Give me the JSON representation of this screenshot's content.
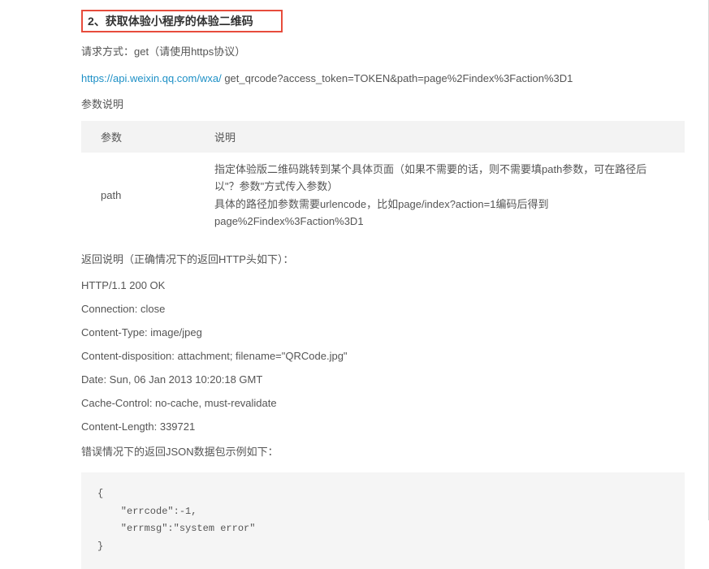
{
  "heading": "2、获取体验小程序的体验二维码",
  "request_method": "请求方式：get（请使用https协议）",
  "api": {
    "link": "https://api.weixin.qq.com/wxa/",
    "rest": " get_qrcode?access_token=TOKEN&path=page%2Findex%3Faction%3D1"
  },
  "param_label": "参数说明",
  "table": {
    "header_param": "参数",
    "header_desc": "说明",
    "row": {
      "param": "path",
      "desc_line1": "指定体验版二维码跳转到某个具体页面（如果不需要的话，则不需要填path参数，可在路径后以\"？参数\"方式传入参数）",
      "desc_line2": "具体的路径加参数需要urlencode，比如page/index?action=1编码后得到page%2Findex%3Faction%3D1"
    }
  },
  "return_label": "返回说明（正确情况下的返回HTTP头如下）：",
  "http_lines": [
    "HTTP/1.1 200 OK",
    "Connection: close",
    "Content-Type: image/jpeg",
    "Content-disposition: attachment; filename=\"QRCode.jpg\"",
    "Date: Sun, 06 Jan 2013 10:20:18 GMT",
    "Cache-Control: no-cache, must-revalidate",
    "Content-Length: 339721"
  ],
  "error_label": "错误情况下的返回JSON数据包示例如下：",
  "code_block": "{\n    \"errcode\":-1,\n    \"errmsg\":\"system error\"\n}"
}
